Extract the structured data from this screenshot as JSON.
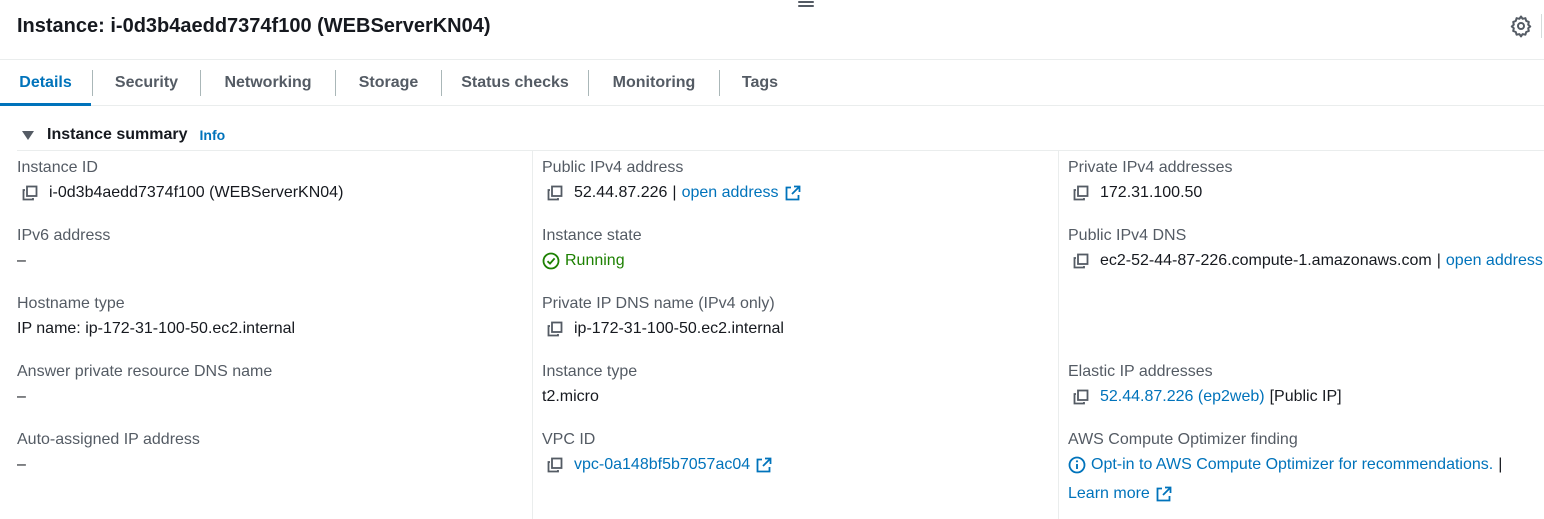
{
  "header": {
    "title": "Instance: i-0d3b4aedd7374f100 (WEBServerKN04)"
  },
  "tabs": [
    {
      "label": "Details",
      "active": true
    },
    {
      "label": "Security"
    },
    {
      "label": "Networking"
    },
    {
      "label": "Storage"
    },
    {
      "label": "Status checks"
    },
    {
      "label": "Monitoring"
    },
    {
      "label": "Tags"
    }
  ],
  "summary": {
    "title": "Instance summary",
    "info": "Info"
  },
  "fields": {
    "instance_id": {
      "label": "Instance ID",
      "value": "i-0d3b4aedd7374f100 (WEBServerKN04)"
    },
    "public_ipv4": {
      "label": "Public IPv4 address",
      "value": "52.44.87.226",
      "sep": "|",
      "link": "open address"
    },
    "private_ipv4": {
      "label": "Private IPv4 addresses",
      "value": "172.31.100.50"
    },
    "ipv6": {
      "label": "IPv6 address",
      "value": "–"
    },
    "instance_state": {
      "label": "Instance state",
      "value": "Running"
    },
    "public_dns": {
      "label": "Public IPv4 DNS",
      "value": "ec2-52-44-87-226.compute-1.amazonaws.com",
      "sep": "|",
      "link": "open address"
    },
    "hostname_type": {
      "label": "Hostname type",
      "value": "IP name: ip-172-31-100-50.ec2.internal"
    },
    "private_dns": {
      "label": "Private IP DNS name (IPv4 only)",
      "value": "ip-172-31-100-50.ec2.internal"
    },
    "answer_dns": {
      "label": "Answer private resource DNS name",
      "value": "–"
    },
    "instance_type": {
      "label": "Instance type",
      "value": "t2.micro"
    },
    "elastic_ip": {
      "label": "Elastic IP addresses",
      "link": "52.44.87.226 (ep2web)",
      "suffix": "[Public IP]"
    },
    "auto_ip": {
      "label": "Auto-assigned IP address",
      "value": "–"
    },
    "vpc_id": {
      "label": "VPC ID",
      "link": "vpc-0a148bf5b7057ac04"
    },
    "optimizer": {
      "label": "AWS Compute Optimizer finding",
      "link": "Opt-in to AWS Compute Optimizer for recommendations.",
      "sep": "|",
      "learn_more": "Learn more"
    }
  },
  "icons": {
    "copy": "copy-icon",
    "external": "external-link-icon",
    "status": "check-circle-icon",
    "info": "info-circle-icon",
    "settings": "gear-icon"
  },
  "colors": {
    "link": "#0073bb",
    "running": "#1d8102",
    "label": "#545b64",
    "text": "#16191f"
  }
}
